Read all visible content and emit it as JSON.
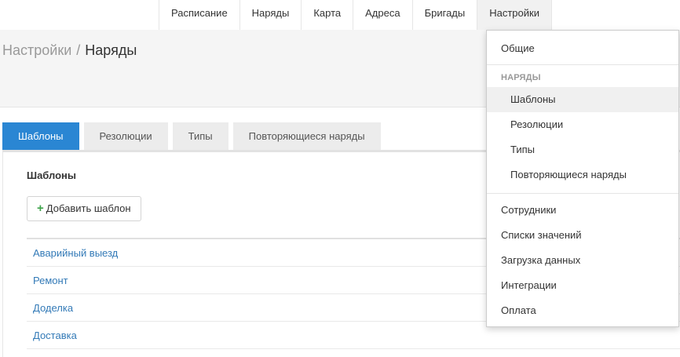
{
  "topnav": {
    "items": [
      "Расписание",
      "Наряды",
      "Карта",
      "Адреса",
      "Бригады",
      "Настройки"
    ]
  },
  "breadcrumb": {
    "parent": "Настройки",
    "separator": "/",
    "current": "Наряды"
  },
  "tabs": [
    "Шаблоны",
    "Резолюции",
    "Типы",
    "Повторяющиеся наряды"
  ],
  "panel": {
    "title": "Шаблоны",
    "add_button_label": "Добавить шаблон",
    "add_button_icon": "plus-icon",
    "rows": [
      "Аварийный выезд",
      "Ремонт",
      "Доделка",
      "Доставка"
    ]
  },
  "dropdown": {
    "general": "Общие",
    "section_header": "НАРЯДЫ",
    "sub_items": [
      "Шаблоны",
      "Резолюции",
      "Типы",
      "Повторяющиеся наряды"
    ],
    "items": [
      "Сотрудники",
      "Списки значений",
      "Загрузка данных",
      "Интеграции",
      "Оплата"
    ]
  },
  "colors": {
    "accent": "#2a86d3",
    "link": "#337ab7",
    "plus": "#3ea34a"
  }
}
